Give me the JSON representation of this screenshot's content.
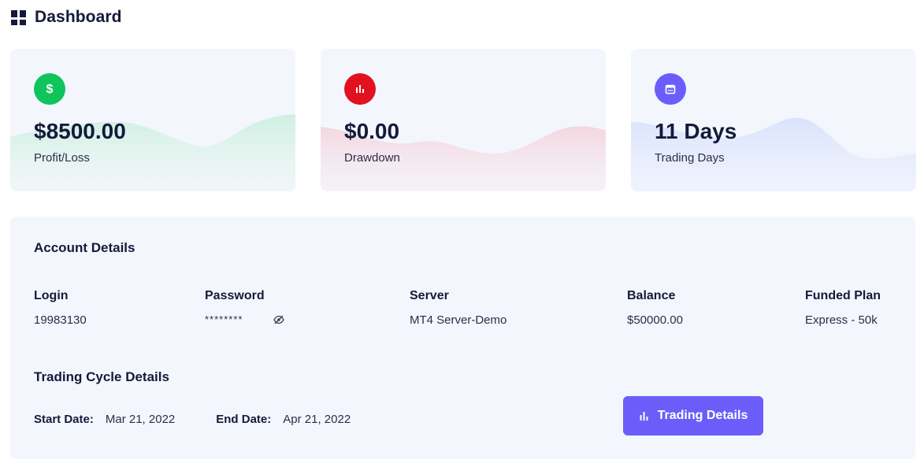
{
  "header": {
    "title": "Dashboard",
    "icon": "dashboard-icon"
  },
  "cards": [
    {
      "value": "$8500.00",
      "label": "Profit/Loss",
      "icon": "dollar-icon",
      "color": "#10c45c"
    },
    {
      "value": "$0.00",
      "label": "Drawdown",
      "icon": "bar-chart-icon",
      "color": "#e3101e"
    },
    {
      "value": "11 Days",
      "label": "Trading Days",
      "icon": "calendar-icon",
      "color": "#6c5dfb"
    }
  ],
  "account": {
    "title": "Account Details",
    "fields": [
      {
        "label": "Login",
        "value": "19983130"
      },
      {
        "label": "Password",
        "value": "********"
      },
      {
        "label": "Server",
        "value": "MT4 Server-Demo"
      },
      {
        "label": "Balance",
        "value": "$50000.00"
      },
      {
        "label": "Funded Plan",
        "value": "Express - 50k"
      }
    ]
  },
  "cycle": {
    "title": "Trading Cycle Details",
    "start_label": "Start Date:",
    "start_value": "Mar 21, 2022",
    "end_label": "End Date:",
    "end_value": "Apr 21, 2022",
    "button_label": "Trading Details"
  },
  "colors": {
    "accent": "#6c5dfb",
    "green": "#10c45c",
    "red": "#e3101e",
    "panel": "#f4f6fd"
  }
}
